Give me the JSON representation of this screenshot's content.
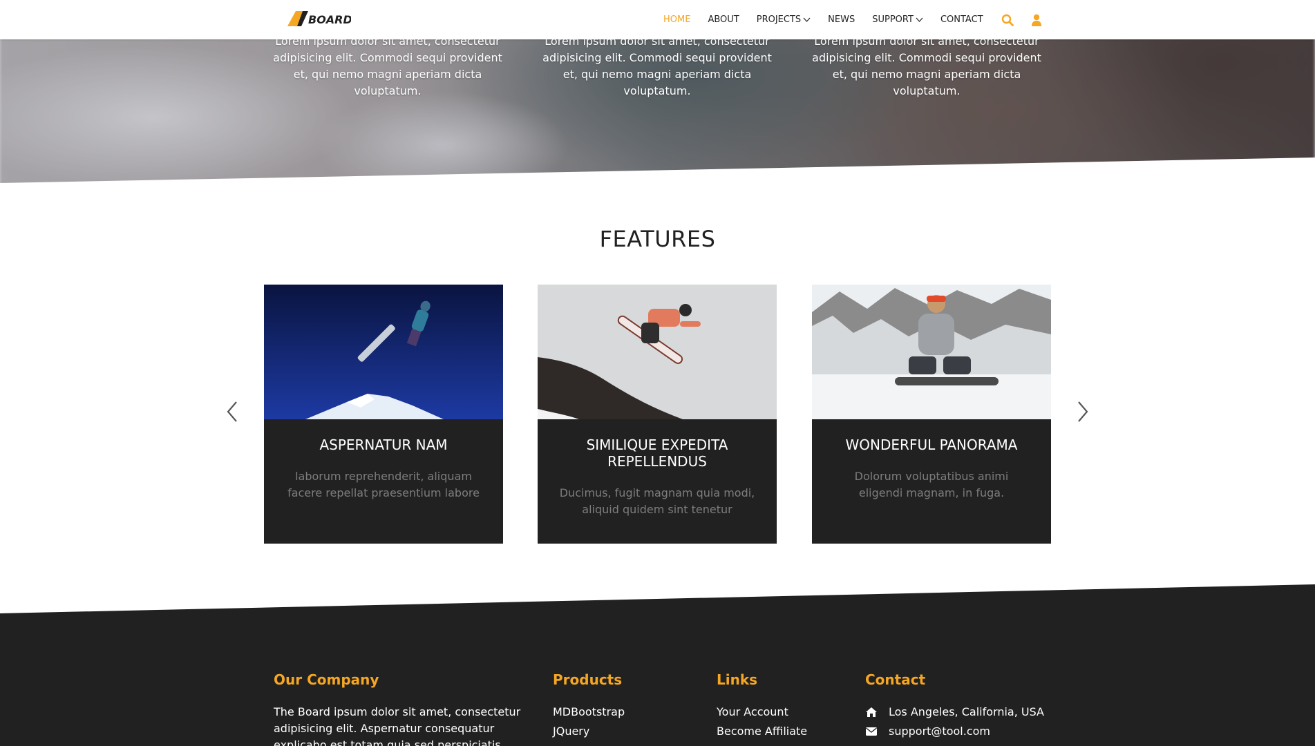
{
  "navbar": {
    "brand": "BOARD",
    "links": [
      {
        "label": "HOME",
        "active": true,
        "dropdown": false
      },
      {
        "label": "ABOUT",
        "active": false,
        "dropdown": false
      },
      {
        "label": "PROJECTS",
        "active": false,
        "dropdown": true
      },
      {
        "label": "NEWS",
        "active": false,
        "dropdown": false
      },
      {
        "label": "SUPPORT",
        "active": false,
        "dropdown": true
      },
      {
        "label": "CONTACT",
        "active": false,
        "dropdown": false
      }
    ],
    "icons": [
      "search-icon",
      "user-icon"
    ]
  },
  "hero": {
    "columns": [
      {
        "text": "Lorem ipsum dolor sit amet, consectetur adipisicing elit. Commodi sequi provident et, qui nemo magni aperiam dicta voluptatum."
      },
      {
        "text": "Lorem ipsum dolor sit amet, consectetur adipisicing elit. Commodi sequi provident et, qui nemo magni aperiam dicta voluptatum."
      },
      {
        "text": "Lorem ipsum dolor sit amet, consectetur adipisicing elit. Commodi sequi provident et, qui nemo magni aperiam dicta voluptatum."
      }
    ]
  },
  "features": {
    "title": "FEATURES",
    "cards": [
      {
        "title": "ASPERNATUR NAM",
        "text": "laborum reprehenderit, aliquam facere repellat praesentium labore"
      },
      {
        "title": "SIMILIQUE EXPEDITA REPELLENDUS",
        "text": "Ducimus, fugit magnam quia modi, aliquid quidem sint tenetur"
      },
      {
        "title": "WONDERFUL PANORAMA",
        "text": "Dolorum voluptatibus animi eligendi magnam, in fuga."
      }
    ]
  },
  "footer": {
    "company": {
      "heading": "Our Company",
      "text": "The Board ipsum dolor sit amet, consectetur adipisicing elit. Aspernatur consequatur explicabo est totam quia sed perspiciatis maxime"
    },
    "products": {
      "heading": "Products",
      "items": [
        "MDBootstrap",
        "JQuery"
      ]
    },
    "links": {
      "heading": "Links",
      "items": [
        "Your Account",
        "Become Affiliate"
      ]
    },
    "contact": {
      "heading": "Contact",
      "items": [
        {
          "icon": "home-icon",
          "text": "Los Angeles, California, USA"
        },
        {
          "icon": "envelope-icon",
          "text": "support@tool.com"
        }
      ]
    }
  },
  "colors": {
    "accent": "#f5a623",
    "dark": "#212121",
    "muted": "#7d7d7d"
  }
}
